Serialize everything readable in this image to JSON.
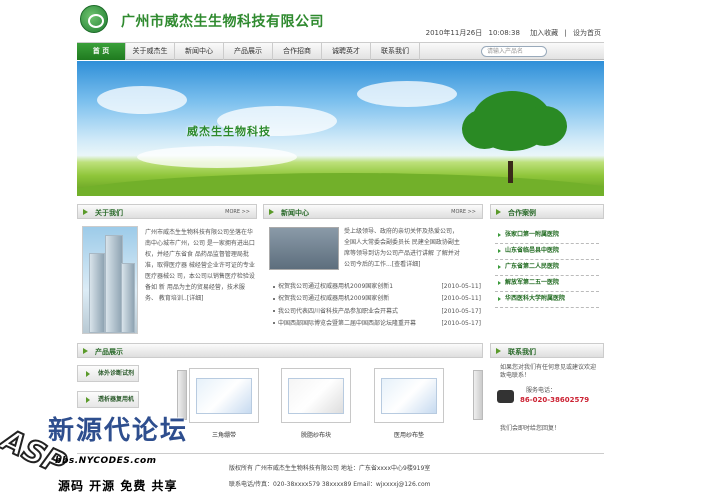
{
  "header": {
    "company_name": "广州市威杰生生物科技有限公司",
    "date": "2010年11月26日",
    "time": "10:08:38",
    "bookmark": "加入收藏",
    "set_home": "设为首页",
    "separator": "|"
  },
  "nav": {
    "items": [
      "首 页",
      "关于威杰生",
      "新闻中心",
      "产品展示",
      "合作招商",
      "诚聘英才",
      "联系我们"
    ],
    "search_placeholder": "请输入产品名"
  },
  "banner": {
    "slogan": "威杰生生物科技"
  },
  "about": {
    "title": "关于我们",
    "more": "MORE >>",
    "text": "广州市威杰生生物科技有限公司坐落在华南中心城市广州，公司 是一家拥有进出口权，并经广东省食 品药品监督管理局批准，取得医疗器 械经营企业许可证的专业医疗器械公 司，本公司以销售医疗检验设备如 新 用品为主的贸易经营，技术服务、 教育培训..[详细]"
  },
  "news": {
    "title": "新闻中心",
    "more": "MORE >>",
    "intro": "受上级领导、政府的亲切关怀及热爱公司，全国人大常委会副委员长 民建全国政协副主席等领导到访为公司产品进行讲解 了解并对公司今后的工作...[查看详细]",
    "items": [
      {
        "title": "祝贺我公司通过权威器用机2009国家创新1",
        "date": "[2010-05-11]"
      },
      {
        "title": "祝贺我公司通过权威器用机2009国家创新",
        "date": "[2010-05-11]"
      },
      {
        "title": "我公司代表四川省科技产品参加职业会开幕式",
        "date": "[2010-05-17]"
      },
      {
        "title": "中国西部国际博览会暨第二届中国西部论坛隆重开幕",
        "date": "[2010-05-17]"
      }
    ]
  },
  "cases": {
    "title": "合作案例",
    "items": [
      "张家口第一附属医院",
      "山东省临邑县中医院",
      "广东省第二人民医院",
      "解放军第二五一医院",
      "华西医科大学附属医院"
    ]
  },
  "products": {
    "title": "产品展示",
    "categories": [
      "体外诊断试剂",
      "透析器复用机"
    ],
    "items": [
      {
        "caption": "三角绷带"
      },
      {
        "caption": "脱脂纱布块"
      },
      {
        "caption": "医用纱布垫"
      }
    ]
  },
  "contact": {
    "title": "联系我们",
    "intro": "如果您对我们有任何意见或建议欢迎致电联系！",
    "hotline_label": "服务电话：",
    "hotline": "86-020-38602579",
    "closing": "我们会即时给您回复！"
  },
  "footer": {
    "line1": "版权所有 广州市威杰生生物科技有限公司  地址：广东省xxxx中心9楼919室",
    "line2": "联系电话/传真：020-38xxxx579 38xxxx89  Email：wjxxxxj@126.com"
  },
  "watermark": {
    "title": "新源代论坛",
    "url": "bbs.NYCODES.com",
    "logo": "ASP",
    "slogan": "源码 开源 免费 共享"
  },
  "colors": {
    "brand_green": "#2f8a2f",
    "nav_active": "#2a8c2a",
    "case_text": "#1f6a1f"
  }
}
